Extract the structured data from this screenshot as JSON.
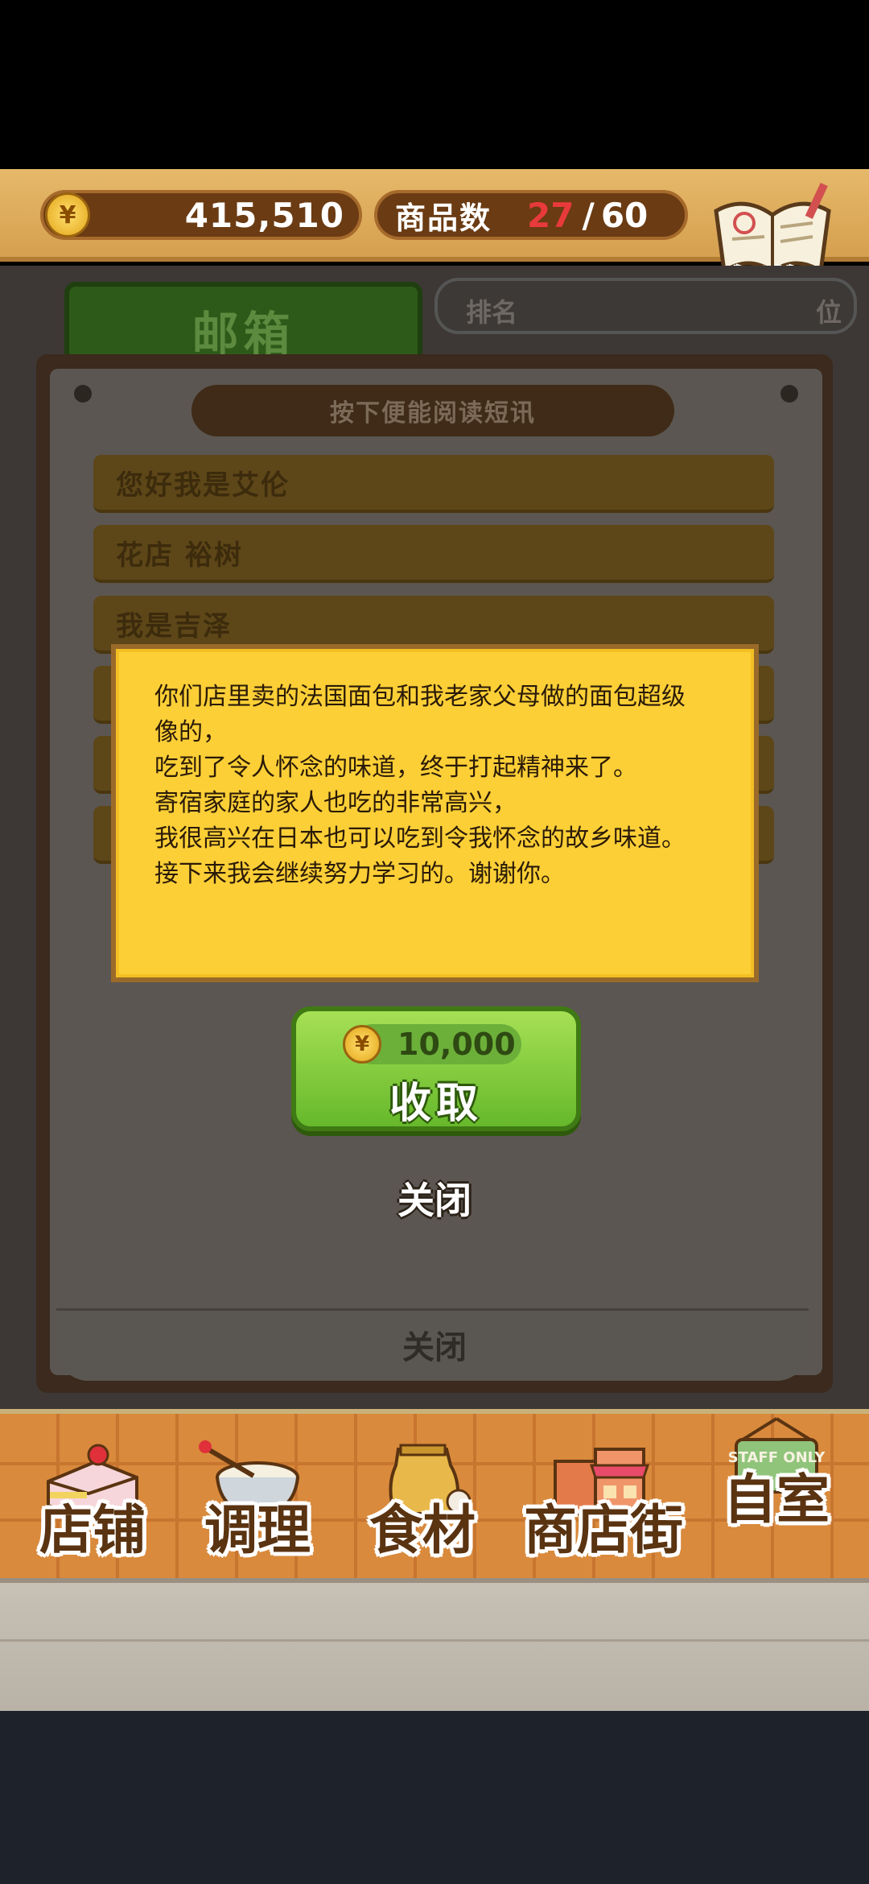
{
  "top_bar": {
    "coin_symbol": "¥",
    "money": "415,510",
    "goods_label": "商品数",
    "goods_current": "27",
    "goods_slash": "/",
    "goods_max": "60",
    "recipe_label": "食谱"
  },
  "tabs": {
    "mailbox": "邮箱",
    "rank_label": "排名",
    "rank_unit": "位"
  },
  "mailbox": {
    "hint": "按下便能阅读短讯",
    "messages": [
      "您好我是艾伦",
      "花店 裕树",
      "我是吉泽"
    ],
    "close_label": "关闭"
  },
  "popup": {
    "lines": [
      "你们店里卖的法国面包和我老家父母做的面包超级",
      "像的，",
      "吃到了令人怀念的味道，终于打起精神来了。",
      "寄宿家庭的家人也吃的非常高兴，",
      "我很高兴在日本也可以吃到令我怀念的故乡味道。",
      "接下来我会继续努力学习的。谢谢你。"
    ],
    "reward_coin": "¥",
    "reward_amount": "10,000",
    "collect_label": "收取",
    "close_label": "关闭"
  },
  "bottom_nav": {
    "items": [
      {
        "label": "店铺",
        "icon": "cake-icon"
      },
      {
        "label": "调理",
        "icon": "mixing-bowl-icon"
      },
      {
        "label": "食材",
        "icon": "flour-sack-icon"
      },
      {
        "label": "商店街",
        "icon": "shop-street-icon"
      },
      {
        "label": "自室",
        "icon": "staff-only-door-icon"
      }
    ],
    "staff_sign_text": "STAFF ONLY"
  },
  "colors": {
    "note_yellow": "#fccf37",
    "collect_green": "#66b82b",
    "goods_current_red": "#e83a3a"
  }
}
